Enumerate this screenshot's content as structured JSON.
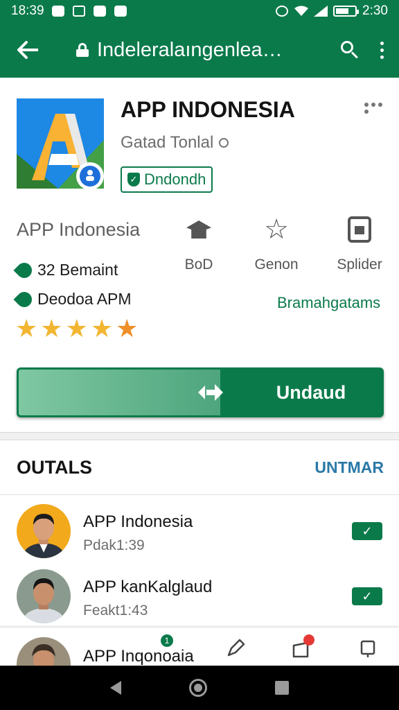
{
  "status_bar": {
    "time": "18:39",
    "right_time": "2:30",
    "battery_level": 0.65
  },
  "app_bar": {
    "url": "Indeleralaıngenlea…"
  },
  "app": {
    "title": "APP INDONESIA",
    "developer": "Gatad Tonlal",
    "badge": "Dndondh",
    "subname": "APP Indonesia",
    "stat1": "32 Bemaint",
    "stat2": "Deodoa APM",
    "rating_stars": 5,
    "categories_link": "Bramahgatams"
  },
  "actions": [
    {
      "label": "BoD",
      "icon": "graduation-cap-icon"
    },
    {
      "label": "Genon",
      "icon": "star-outline-icon"
    },
    {
      "label": "Splider",
      "icon": "package-icon"
    }
  ],
  "install": {
    "label": "Undaud",
    "progress_fraction": 0.56
  },
  "section": {
    "title": "OUTALS",
    "link": "UNTMAR",
    "items": [
      {
        "title": "APP Indonesia",
        "subtitle": "Pdak1:39"
      },
      {
        "title": "APP kanKalglaud",
        "subtitle": "Feakt1:43"
      }
    ]
  },
  "bottom_bar": {
    "peek_title": "APP Inqonoaia",
    "notif_count": "1"
  },
  "colors": {
    "primary": "#0b7a4b",
    "link_blue": "#2a79a7",
    "star": "#f2b632",
    "star_last": "#ef8f2a",
    "alert": "#e53935"
  }
}
